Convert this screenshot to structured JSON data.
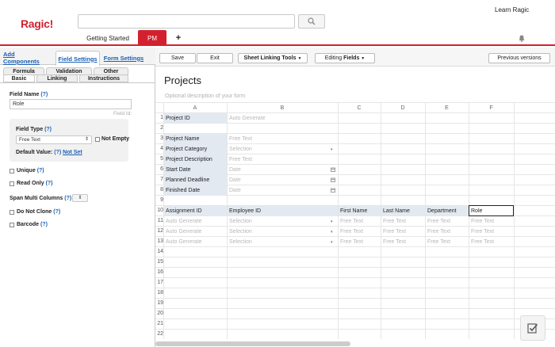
{
  "app": {
    "logo": "Ragic!",
    "learn_label": "Learn Ragic"
  },
  "search": {
    "placeholder": ""
  },
  "tabs": [
    {
      "label": "Getting Started"
    },
    {
      "label": "PM"
    },
    {
      "label": "+"
    }
  ],
  "sidebar": {
    "tabs": [
      "Add Components",
      "Field Settings",
      "Form Settings"
    ],
    "subtabs_top": [
      "Formula",
      "Validation",
      "Other"
    ],
    "subtabs_bottom": [
      "Basic",
      "Linking",
      "Instructions"
    ],
    "field_name_label": "Field Name",
    "help": "(?)",
    "field_name_value": "Role",
    "field_id_label": "Field Id:",
    "field_type_label": "Field Type",
    "field_type_value": "Free Text",
    "not_empty_label": "Not Empty",
    "default_value_label": "Default Value:",
    "not_set_label": "Not Set",
    "unique_label": "Unique",
    "read_only_label": "Read Only",
    "span_label": "Span Multi Columns",
    "do_not_clone_label": "Do Not Clone",
    "barcode_label": "Barcode"
  },
  "toolbar": {
    "save": "Save",
    "exit": "Exit",
    "sheet_linking": "Sheet Linking Tools",
    "editing_prefix": "Editing",
    "editing_bold": "Fields",
    "previous": "Previous versions"
  },
  "form": {
    "title": "Projects",
    "description_placeholder": "Optional description of your form",
    "columns": [
      "A",
      "B",
      "C",
      "D",
      "E",
      "F"
    ],
    "rows": [
      "1",
      "2",
      "3",
      "4",
      "5",
      "6",
      "7",
      "8",
      "9",
      "10",
      "11",
      "12",
      "13",
      "14",
      "15",
      "16",
      "17",
      "18",
      "19",
      "20",
      "21",
      "22"
    ],
    "fields": [
      {
        "label": "Project ID",
        "value": "Auto Generate"
      },
      {
        "label": "Project Name",
        "value": "Free Text"
      },
      {
        "label": "Project Category",
        "value": "Selection"
      },
      {
        "label": "Project Description",
        "value": "Free Text"
      },
      {
        "label": "Start Date",
        "value": "Date"
      },
      {
        "label": "Planned Deadline",
        "value": "Date"
      },
      {
        "label": "Finished Date",
        "value": "Date"
      }
    ],
    "subtable_headers": [
      "Assignment ID",
      "Employee ID",
      "First Name",
      "Last Name",
      "Department",
      "Role"
    ],
    "subtable_row": [
      "Auto Generate",
      "Selection",
      "Free Text",
      "Free Text",
      "Free Text",
      "Free Text"
    ]
  },
  "colors": {
    "brand": "#d3202e",
    "link": "#1a5fb4",
    "label_bg": "#e3e9f0"
  },
  "icons": [
    "search-icon",
    "bell-icon",
    "dropdown-arrow-icon",
    "calendar-icon",
    "checklist-icon"
  ]
}
